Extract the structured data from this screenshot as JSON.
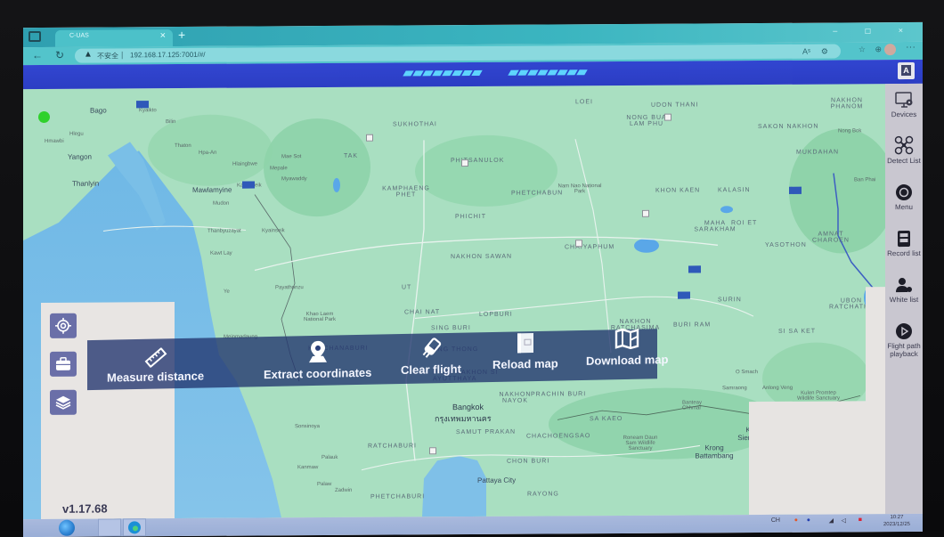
{
  "browser": {
    "tab_title": "C-UAS",
    "tab_close": "×",
    "new_tab": "+",
    "insecure_label": "不安全",
    "url": "192.168.17.125:7001/#/",
    "read_aloud": "Aˢ",
    "window_controls": "– ◻ ×",
    "more": "···"
  },
  "app": {
    "lang_button": "A",
    "version": "v1.17.68",
    "status_color": "#2fd12c",
    "accent": "#2437c2"
  },
  "toolbar": {
    "items": [
      {
        "id": "measure-distance",
        "label": "Measure distance",
        "icon": "ruler-icon"
      },
      {
        "id": "extract-coordinates",
        "label": "Extract coordinates",
        "icon": "map-pin-icon"
      },
      {
        "id": "clear-flight",
        "label": "Clear flight",
        "icon": "eraser-icon"
      },
      {
        "id": "reload-map",
        "label": "Reload map",
        "icon": "reload-map-icon"
      },
      {
        "id": "download-map",
        "label": "Download map",
        "icon": "map-download-icon"
      }
    ]
  },
  "left_panel": {
    "buttons": [
      {
        "id": "locate",
        "icon": "crosshair-icon"
      },
      {
        "id": "toolbox",
        "icon": "toolbox-icon"
      },
      {
        "id": "layers",
        "icon": "layers-icon"
      }
    ]
  },
  "right_sidebar": {
    "items": [
      {
        "id": "devices",
        "label": "Devices",
        "icon": "monitor-gear-icon"
      },
      {
        "id": "detect-list",
        "label": "Detect List",
        "icon": "drone-icon"
      },
      {
        "id": "menu",
        "label": "Menu",
        "icon": "gear-icon"
      },
      {
        "id": "record-list",
        "label": "Record list",
        "icon": "database-icon"
      },
      {
        "id": "white-list",
        "label": "White list",
        "icon": "user-add-icon"
      },
      {
        "id": "flight-path-playback",
        "label": "Flight path playback",
        "icon": "play-icon"
      }
    ]
  },
  "map": {
    "labels": [
      {
        "text": "Bago",
        "kind": "city"
      },
      {
        "text": "Yangon",
        "kind": "city"
      },
      {
        "text": "Thanlyin",
        "kind": "city"
      },
      {
        "text": "Mawlamyine",
        "kind": "city"
      },
      {
        "text": "Hlegu",
        "kind": "small"
      },
      {
        "text": "Kyaikto",
        "kind": "small"
      },
      {
        "text": "Bilin",
        "kind": "small"
      },
      {
        "text": "Thaton",
        "kind": "small"
      },
      {
        "text": "Hpa-An",
        "kind": "small"
      },
      {
        "text": "Hmawbi",
        "kind": "small"
      },
      {
        "text": "Hlaingbwe",
        "kind": "small"
      },
      {
        "text": "Kawkareik",
        "kind": "small"
      },
      {
        "text": "Mudon",
        "kind": "small"
      },
      {
        "text": "Thanbyuzayat",
        "kind": "small"
      },
      {
        "text": "Kawt Lay",
        "kind": "small"
      },
      {
        "text": "Ye",
        "kind": "small"
      },
      {
        "text": "Kyainseik",
        "kind": "small"
      },
      {
        "text": "Payathonzu",
        "kind": "small"
      },
      {
        "text": "Khao Laem National Park",
        "kind": "small"
      },
      {
        "text": "Meinmadaung",
        "kind": "small"
      },
      {
        "text": "Mae Sot",
        "kind": "small"
      },
      {
        "text": "Mepale",
        "kind": "small"
      },
      {
        "text": "Myawaddy",
        "kind": "small"
      },
      {
        "text": "SUKHOTHAI",
        "kind": "region"
      },
      {
        "text": "TAK",
        "kind": "region"
      },
      {
        "text": "PHITSANULOK",
        "kind": "region"
      },
      {
        "text": "KAMPHAENG PHET",
        "kind": "region"
      },
      {
        "text": "PHICHIT",
        "kind": "region"
      },
      {
        "text": "PHETCHABUN",
        "kind": "region"
      },
      {
        "text": "LOEI",
        "kind": "region"
      },
      {
        "text": "UDON THANI",
        "kind": "region"
      },
      {
        "text": "NONG BUA LAM PHU",
        "kind": "region"
      },
      {
        "text": "SAKON NAKHON",
        "kind": "region"
      },
      {
        "text": "NAKHON PHANOM",
        "kind": "region"
      },
      {
        "text": "KHON KAEN",
        "kind": "region"
      },
      {
        "text": "KALASIN",
        "kind": "region"
      },
      {
        "text": "MUKDAHAN",
        "kind": "region"
      },
      {
        "text": "MAHA SARAKHAM",
        "kind": "region"
      },
      {
        "text": "ROI ET",
        "kind": "region"
      },
      {
        "text": "YASOTHON",
        "kind": "region"
      },
      {
        "text": "AMNAT CHAROEN",
        "kind": "region"
      },
      {
        "text": "CHAIYAPHUM",
        "kind": "region"
      },
      {
        "text": "NAKHON SAWAN",
        "kind": "region"
      },
      {
        "text": "UT",
        "kind": "region"
      },
      {
        "text": "CHAI NAT",
        "kind": "region"
      },
      {
        "text": "SING BURI",
        "kind": "region"
      },
      {
        "text": "LOPBURI",
        "kind": "region"
      },
      {
        "text": "NAKHON RATCHASIMA",
        "kind": "region"
      },
      {
        "text": "BURI RAM",
        "kind": "region"
      },
      {
        "text": "SURIN",
        "kind": "region"
      },
      {
        "text": "SI SA KET",
        "kind": "region"
      },
      {
        "text": "UBON RATCHATHANI",
        "kind": "region"
      },
      {
        "text": "KANCHANABURI",
        "kind": "region"
      },
      {
        "text": "ANG THONG",
        "kind": "region"
      },
      {
        "text": "PHRA NAKHON SI AYUTTHAYA",
        "kind": "region"
      },
      {
        "text": "NAKHON NAYOK",
        "kind": "region"
      },
      {
        "text": "PRACHIN BURI",
        "kind": "region"
      },
      {
        "text": "Bangkok",
        "kind": "big"
      },
      {
        "text": "กรุงเทพมหานคร",
        "kind": "big"
      },
      {
        "text": "SAMUT PRAKAN",
        "kind": "region"
      },
      {
        "text": "CHACHOENGSAO",
        "kind": "region"
      },
      {
        "text": "SA KAEO",
        "kind": "region"
      },
      {
        "text": "RATCHABURI",
        "kind": "region"
      },
      {
        "text": "CHON BURI",
        "kind": "region"
      },
      {
        "text": "Pattaya City",
        "kind": "city"
      },
      {
        "text": "RAYONG",
        "kind": "region"
      },
      {
        "text": "PHETCHABURI",
        "kind": "region"
      },
      {
        "text": "Krong Battambang",
        "kind": "city"
      },
      {
        "text": "Krong Siem Reap",
        "kind": "city"
      },
      {
        "text": "Sonsinoya",
        "kind": "small"
      },
      {
        "text": "Palauk",
        "kind": "small"
      },
      {
        "text": "Kanmaw",
        "kind": "small"
      },
      {
        "text": "Palaw",
        "kind": "small"
      },
      {
        "text": "Zadwin",
        "kind": "small"
      },
      {
        "text": "O Smach",
        "kind": "small"
      },
      {
        "text": "Samraong",
        "kind": "small"
      },
      {
        "text": "Anlong Veng",
        "kind": "small"
      },
      {
        "text": "Kulen Promtep Wildlife Sanctuary",
        "kind": "small"
      },
      {
        "text": "Banteay Chhmar",
        "kind": "small"
      },
      {
        "text": "Roneam Daun Sam Wildlife Sanctuary",
        "kind": "small"
      },
      {
        "text": "Nam Nao National Park",
        "kind": "small"
      },
      {
        "text": "Nong Bok",
        "kind": "small"
      },
      {
        "text": "Ban Phai",
        "kind": "small"
      }
    ]
  },
  "taskbar": {
    "tray_text": "CH",
    "time": "10:27",
    "date": "2023/12/25"
  }
}
